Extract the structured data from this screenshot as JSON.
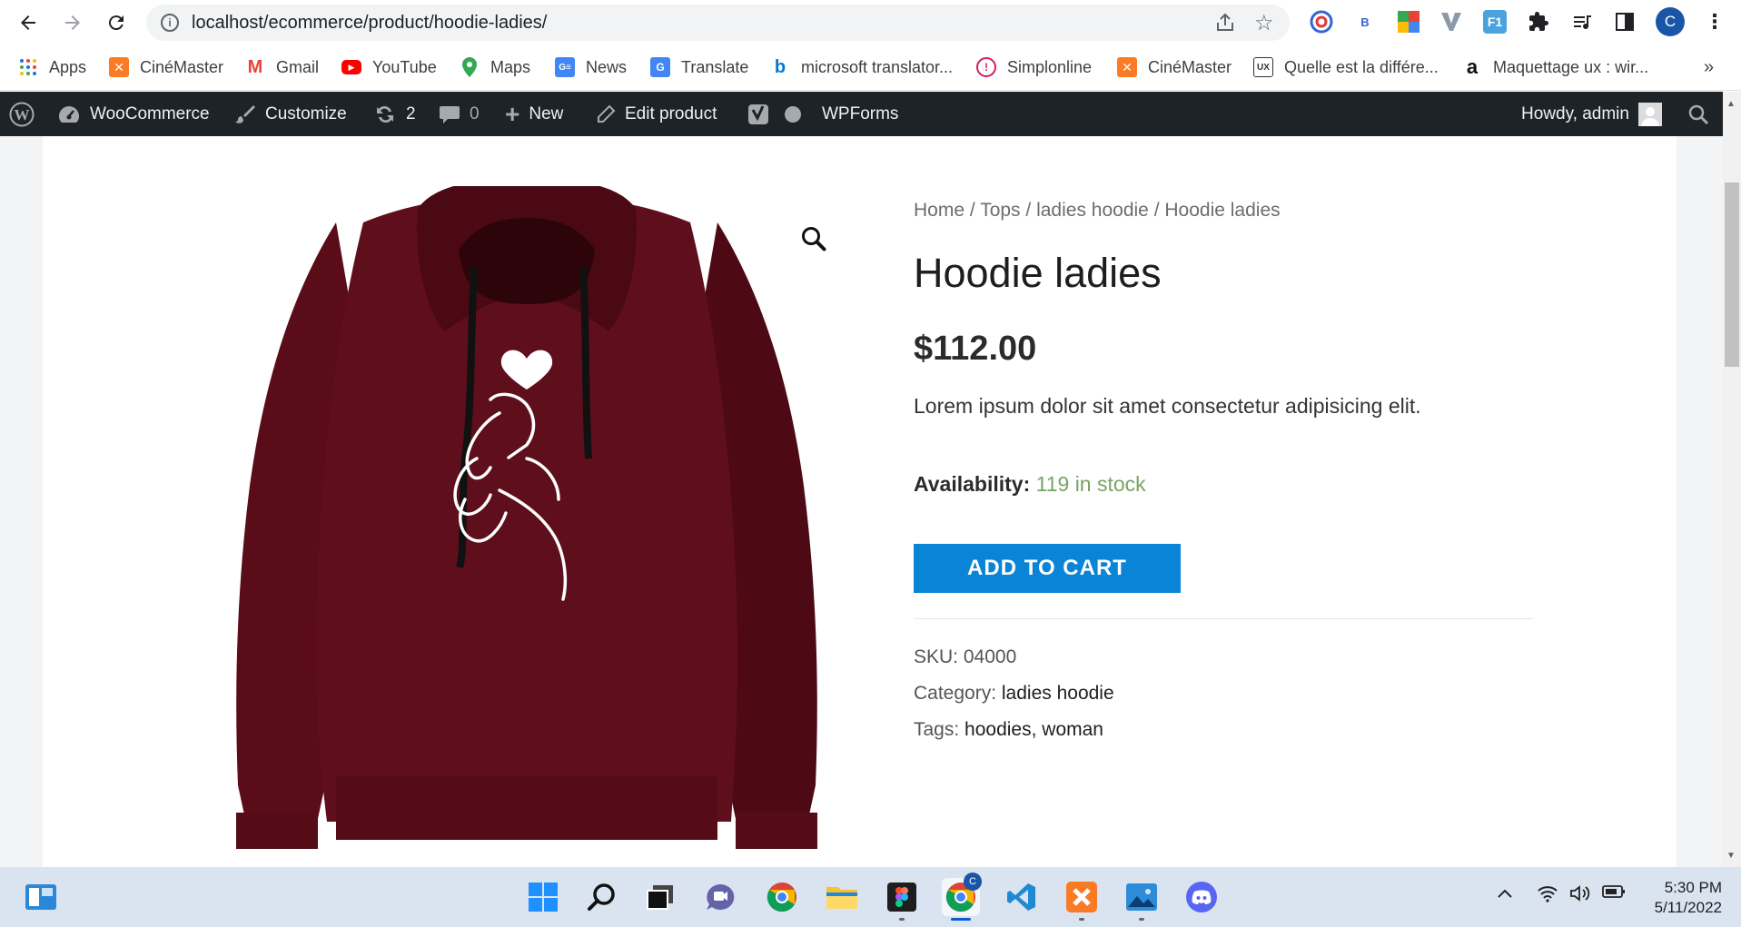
{
  "browser": {
    "url": "localhost/ecommerce/product/hoodie-ladies/",
    "profile_initial": "C",
    "extensions": [
      "B"
    ],
    "bookmarks": [
      {
        "label": "Apps",
        "icon": "apps-grid-icon"
      },
      {
        "label": "CinéMaster",
        "icon": "xampp-icon"
      },
      {
        "label": "Gmail",
        "icon": "gmail-icon"
      },
      {
        "label": "YouTube",
        "icon": "youtube-icon"
      },
      {
        "label": "Maps",
        "icon": "maps-pin-icon"
      },
      {
        "label": "News",
        "icon": "news-icon"
      },
      {
        "label": "Translate",
        "icon": "translate-icon"
      },
      {
        "label": "microsoft translator...",
        "icon": "bing-icon"
      },
      {
        "label": "Simplonline",
        "icon": "simplonline-icon"
      },
      {
        "label": "CinéMaster",
        "icon": "xampp-icon"
      },
      {
        "label": "Quelle est la différe...",
        "icon": "blog-ux-icon"
      },
      {
        "label": "Maquettage ux : wir...",
        "icon": "amazon-a-icon"
      }
    ],
    "more_bookmarks": "»"
  },
  "admin_bar": {
    "woocommerce": "WooCommerce",
    "customize": "Customize",
    "updates_count": "2",
    "comments_count": "0",
    "new": "New",
    "edit_product": "Edit product",
    "wpforms": "WPForms",
    "howdy": "Howdy, admin"
  },
  "product": {
    "breadcrumb": {
      "home": "Home",
      "sep": "/",
      "tops": "Tops",
      "category": "ladies hoodie",
      "current": "Hoodie ladies"
    },
    "title": "Hoodie ladies",
    "price": "$112.00",
    "description": "Lorem ipsum dolor sit amet consectetur adipisicing elit.",
    "availability_label": "Availability:",
    "availability_value": "119 in stock",
    "add_to_cart": "ADD TO CART",
    "sku_label": "SKU:",
    "sku": "04000",
    "category_label": "Category:",
    "category": "ladies hoodie",
    "tags_label": "Tags:",
    "tags": "hoodies, woman",
    "image_color": "#5a0d19"
  },
  "taskbar": {
    "time": "5:30 PM",
    "date": "5/11/2022",
    "chrome_badge": "C"
  }
}
